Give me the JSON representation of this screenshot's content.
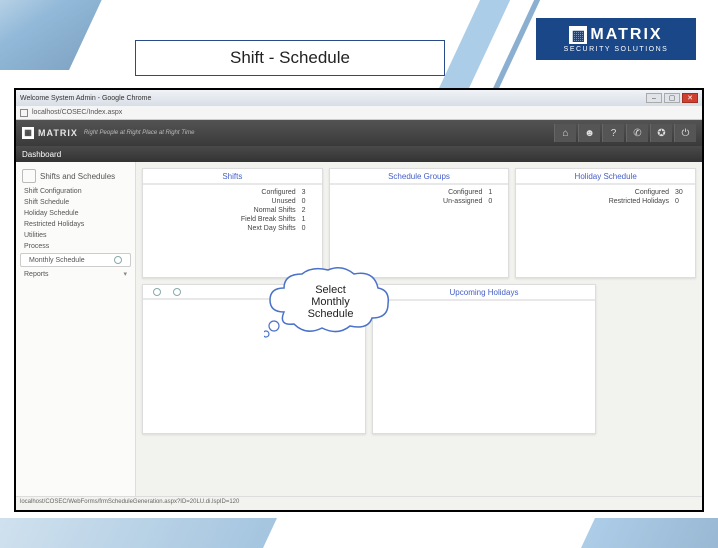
{
  "slide": {
    "title": "Shift - Schedule",
    "logo_name": "MATRIX",
    "logo_tagline": "SECURITY SOLUTIONS"
  },
  "browser": {
    "window_title": "Welcome System Admin - Google Chrome",
    "url": "localhost/COSEC/Index.aspx",
    "status_url": "localhost/COSEC/WebForms/frmScheduleGeneration.aspx?ID=20LU.di.lspID=120"
  },
  "app": {
    "brand": "MATRIX",
    "tagline": "Right People at Right Place at Right Time",
    "tab": "Dashboard"
  },
  "sidebar": {
    "group_title": "Shifts and Schedules",
    "items": [
      "Shift Configuration",
      "Shift Schedule",
      "Holiday Schedule",
      "Restricted Holidays",
      "Utilities",
      "Process"
    ],
    "selected": "Monthly Schedule",
    "footer_item": "Reports"
  },
  "dashboard": {
    "panels": {
      "shifts": {
        "title": "Shifts",
        "stats": [
          {
            "label": "Configured",
            "value": "3"
          },
          {
            "label": "Unused",
            "value": "0"
          },
          {
            "label": "Normal Shifts",
            "value": "2"
          },
          {
            "label": "Field Break Shifts",
            "value": "1"
          },
          {
            "label": "Next Day Shifts",
            "value": "0"
          }
        ]
      },
      "schedule_groups": {
        "title": "Schedule Groups",
        "stats": [
          {
            "label": "Configured",
            "value": "1"
          },
          {
            "label": "Un-assigned",
            "value": "0"
          }
        ]
      },
      "holiday_schedule": {
        "title": "Holiday Schedule",
        "stats": [
          {
            "label": "Configured",
            "value": "30"
          },
          {
            "label": "Restricted Holidays",
            "value": "0"
          }
        ]
      },
      "upcoming_holidays": {
        "title": "Upcoming Holidays"
      }
    }
  },
  "callout": {
    "line1": "Select",
    "line2": "Monthly",
    "line3": "Schedule"
  }
}
